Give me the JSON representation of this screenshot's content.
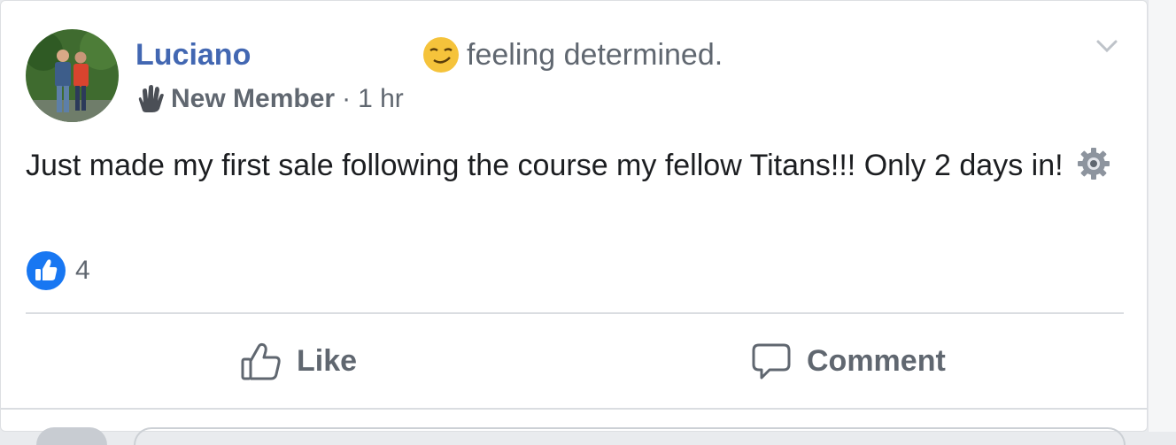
{
  "post": {
    "author": "Luciano",
    "feeling": "feeling determined.",
    "feeling_icon": "smirking-face-icon",
    "badge": "New Member",
    "badge_icon": "waving-hand-icon",
    "separator": "·",
    "time": "1 hr",
    "text": "Just made my first sale following the course my fellow Titans!!! Only 2 days in!",
    "text_icon": "gear-icon"
  },
  "reactions": {
    "icon": "like-reaction-icon",
    "count": "4"
  },
  "actions": {
    "like_label": "Like",
    "comment_label": "Comment"
  },
  "colors": {
    "author": "#4267b2",
    "muted_text": "#606770",
    "body_text": "#1c1e21",
    "like_blue": "#1877f2",
    "divider": "#dadde1"
  }
}
